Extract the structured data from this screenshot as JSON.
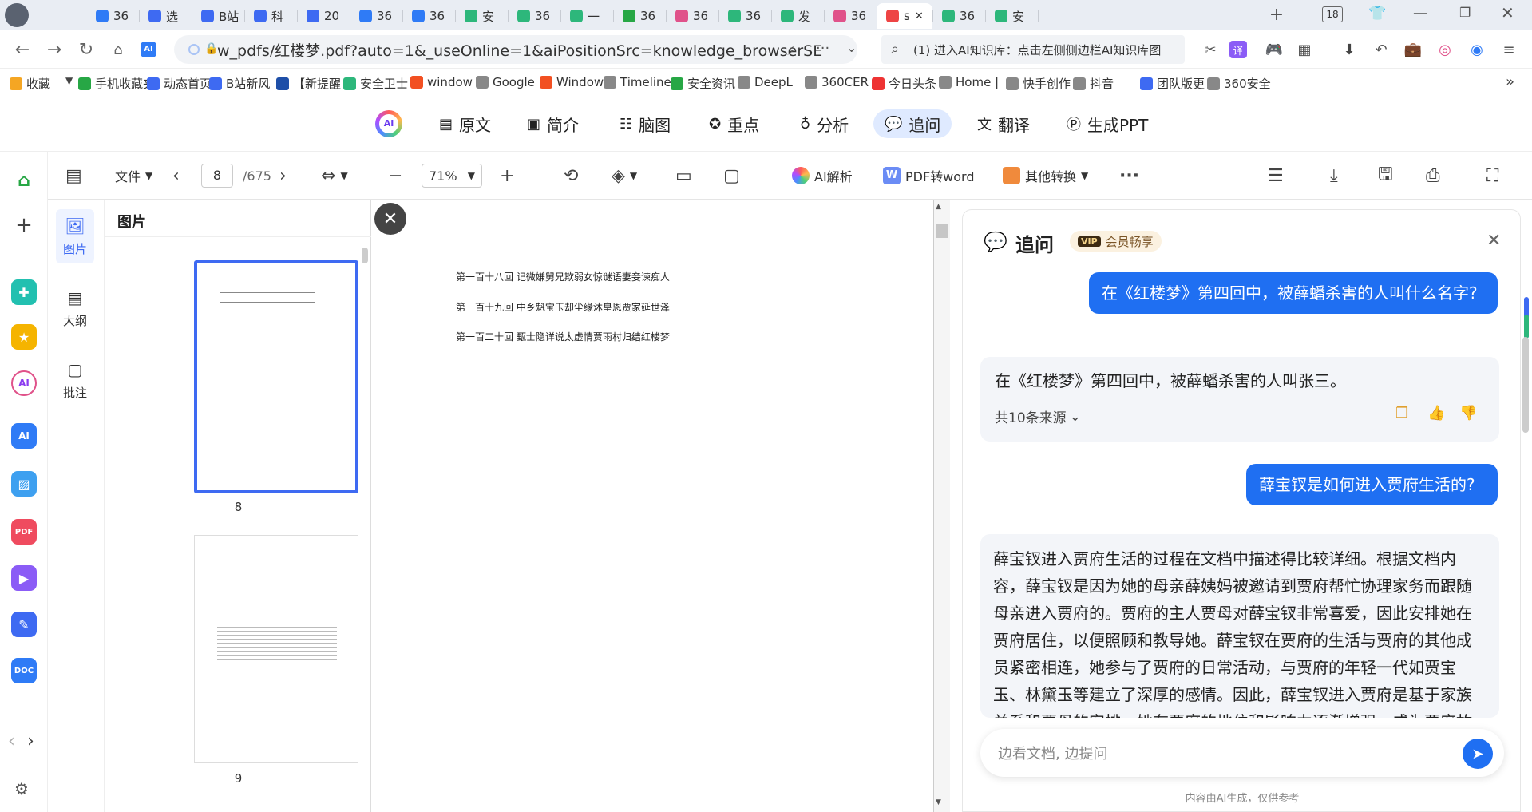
{
  "tabs": [
    {
      "label": "36",
      "color": "#2f7bf6",
      "icon": "ai-icon"
    },
    {
      "label": "选",
      "color": "#3e6af2",
      "icon": "gear-icon"
    },
    {
      "label": "B站",
      "color": "#3e6af2",
      "icon": "tv-icon"
    },
    {
      "label": "科",
      "color": "#3e6af2",
      "icon": "tv-icon"
    },
    {
      "label": "20",
      "color": "#3e6af2",
      "icon": "tv-icon"
    },
    {
      "label": "36",
      "color": "#2f7bf6",
      "icon": "ai-icon"
    },
    {
      "label": "36",
      "color": "#2f7bf6",
      "icon": "ai-icon"
    },
    {
      "label": "安",
      "color": "#2db77b",
      "icon": "360-icon"
    },
    {
      "label": "36",
      "color": "#2db77b",
      "icon": "360-icon"
    },
    {
      "label": "一",
      "color": "#2db77b",
      "icon": "360-icon"
    },
    {
      "label": "36",
      "color": "#27a745",
      "icon": "e-icon"
    },
    {
      "label": "36",
      "color": "#e0528a",
      "icon": "ai-icon"
    },
    {
      "label": "36",
      "color": "#2db77b",
      "icon": "360-icon"
    },
    {
      "label": "发",
      "color": "#2db77b",
      "icon": "360-icon"
    },
    {
      "label": "36",
      "color": "#e0528a",
      "icon": "ai-icon"
    },
    {
      "label": "s",
      "color": "#e44",
      "icon": "pdf-icon",
      "active": true
    },
    {
      "label": "36",
      "color": "#2db77b",
      "icon": "360-icon"
    },
    {
      "label": "安",
      "color": "#2db77b",
      "icon": "360-icon"
    }
  ],
  "tab_count": "18",
  "address": {
    "url": "w_pdfs/红楼梦.pdf?auto=1&_useOnline=1&aiPositionSrc=knowledge_browserSE",
    "search": "(1) 进入AI知识库：点击左侧侧边栏AI知识库图"
  },
  "bookmarks": [
    {
      "label": "收藏",
      "color": "#f5a623"
    },
    {
      "label": "手机收藏夹",
      "color": "#27a745"
    },
    {
      "label": "动态首页",
      "color": "#3e6af2"
    },
    {
      "label": "B站新风",
      "color": "#3e6af2"
    },
    {
      "label": "【新提醒",
      "color": "#1e4fa8"
    },
    {
      "label": "安全卫士",
      "color": "#2db77b"
    },
    {
      "label": "window",
      "color": "#f25022"
    },
    {
      "label": "Google",
      "color": "#888"
    },
    {
      "label": "Window",
      "color": "#f25022"
    },
    {
      "label": "Timeline",
      "color": "#888"
    },
    {
      "label": "安全资讯",
      "color": "#27a745"
    },
    {
      "label": "DeepL",
      "color": "#888"
    },
    {
      "label": "360CER",
      "color": "#888"
    },
    {
      "label": "今日头条",
      "color": "#e33"
    },
    {
      "label": "Home |",
      "color": "#888"
    },
    {
      "label": "快手创作",
      "color": "#888"
    },
    {
      "label": "抖音",
      "color": "#888"
    },
    {
      "label": "团队版更",
      "color": "#3e6af2"
    },
    {
      "label": "360安全",
      "color": "#888"
    }
  ],
  "ai_tabs": [
    "原文",
    "简介",
    "脑图",
    "重点",
    "分析",
    "追问",
    "翻译",
    "生成PPT"
  ],
  "doc_toolbar": {
    "file_label": "文件",
    "page": "8",
    "total": "/675",
    "zoom": "71%",
    "ai_parse": "AI解析",
    "pdf2word": "PDF转word",
    "other_convert": "其他转换"
  },
  "side_panel": {
    "title": "图片",
    "tabs": [
      "图片",
      "大纲",
      "批注"
    ],
    "thumb_numbers": [
      "8",
      "9"
    ]
  },
  "doc_lines": [
    "第一百十八回  记微嫌舅兄欺弱女惊谜语妻妾谏痴人",
    "第一百十九回  中乡魁宝玉却尘缘沐皇恩贾家延世泽",
    "第一百二十回  甄士隐详说太虚情贾雨村归结红楼梦"
  ],
  "chat": {
    "title": "追问",
    "vip_badge": "会员畅享",
    "q1": "在《红楼梦》第四回中，被薛蟠杀害的人叫什么名字?",
    "a1": "在《红楼梦》第四回中，被薛蟠杀害的人叫张三。",
    "sources": "共10条来源",
    "q2": "薛宝钗是如何进入贾府生活的?",
    "a2": "薛宝钗进入贾府生活的过程在文档中描述得比较详细。根据文档内容，薛宝钗是因为她的母亲薛姨妈被邀请到贾府帮忙协理家务而跟随母亲进入贾府的。贾府的主人贾母对薛宝钗非常喜爱，因此安排她在贾府居住，以便照顾和教导她。薛宝钗在贾府的生活与贾府的其他成员紧密相连，她参与了贾府的日常活动，与贾府的年轻一代如贾宝玉、林黛玉等建立了深厚的感情。因此，薛宝钗进入贾府是基于家族关系和贾母的安排，她在贾府的地位和影响力逐渐增强，成为贾府故",
    "input_placeholder": "边看文档, 边提问",
    "disclaimer": "内容由AI生成，仅供参考"
  }
}
